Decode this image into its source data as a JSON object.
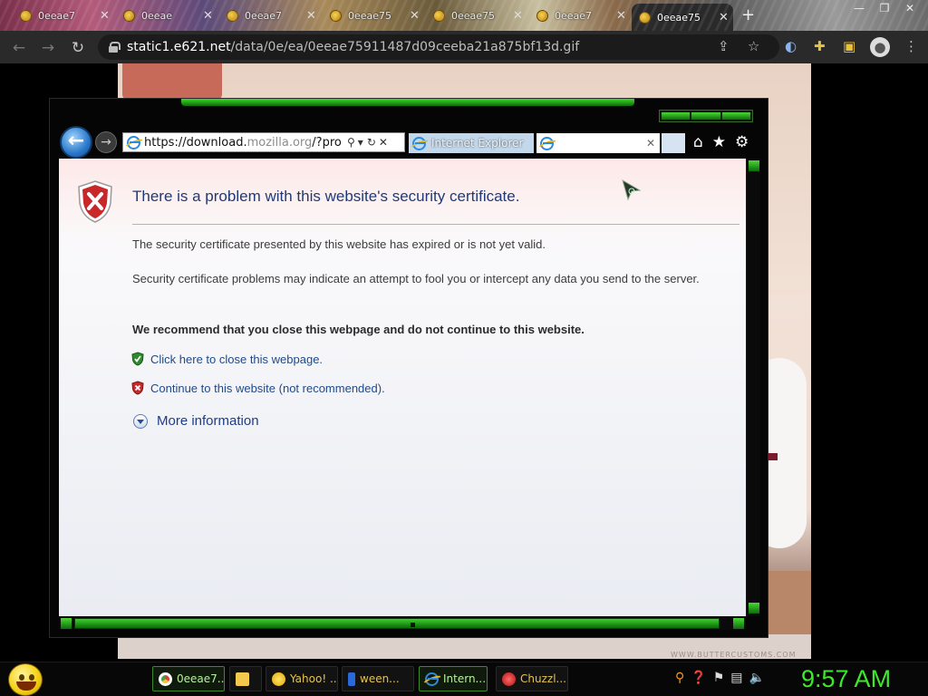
{
  "chrome": {
    "tabs": [
      {
        "title": "0eeae7"
      },
      {
        "title": "0eeae"
      },
      {
        "title": "0eeae7"
      },
      {
        "title": "0eeae75"
      },
      {
        "title": "0eeae75"
      },
      {
        "title": "0eeae7"
      },
      {
        "title": "0eeae75"
      }
    ],
    "url_host": "static1.e621.net",
    "url_path": "/data/0e/ea/0eeae75911487d09ceeba21a875bf13d.gif"
  },
  "ie": {
    "address_prefix": "https://download.",
    "address_domain": "mozilla.org",
    "address_suffix": "/?product",
    "tab1_title": "Internet Explorer",
    "tab2_title": ""
  },
  "error_page": {
    "title": "There is a problem with this website's security certificate.",
    "para1": "The security certificate presented by this website has expired or is not yet valid.",
    "para2": "Security certificate problems may indicate an attempt to fool you or intercept any data you send to the server.",
    "recommend": "We recommend that you close this webpage and do not continue to this website.",
    "close_link": "Click here to close this webpage.",
    "continue_link": "Continue to this website (not recommended).",
    "more_info": "More information"
  },
  "background": {
    "watermark": "WWW.BUTTERCUSTOMS.COM"
  },
  "taskbar": {
    "buttons": [
      {
        "label": "0eeae7...",
        "active": true
      },
      {
        "label": "",
        "active": false
      },
      {
        "label": "Yahoo! ...",
        "active": false
      },
      {
        "label": "ween...",
        "active": false
      },
      {
        "label": "Intern...",
        "active": true
      },
      {
        "label": "Chuzzl...",
        "active": false
      }
    ],
    "clock": "9:57 AM"
  },
  "colors": {
    "accent_green": "#3ee82a",
    "link_blue": "#1e4a8a",
    "title_blue": "#1f3a78",
    "chrome_toolbar": "#2a2a2a"
  }
}
